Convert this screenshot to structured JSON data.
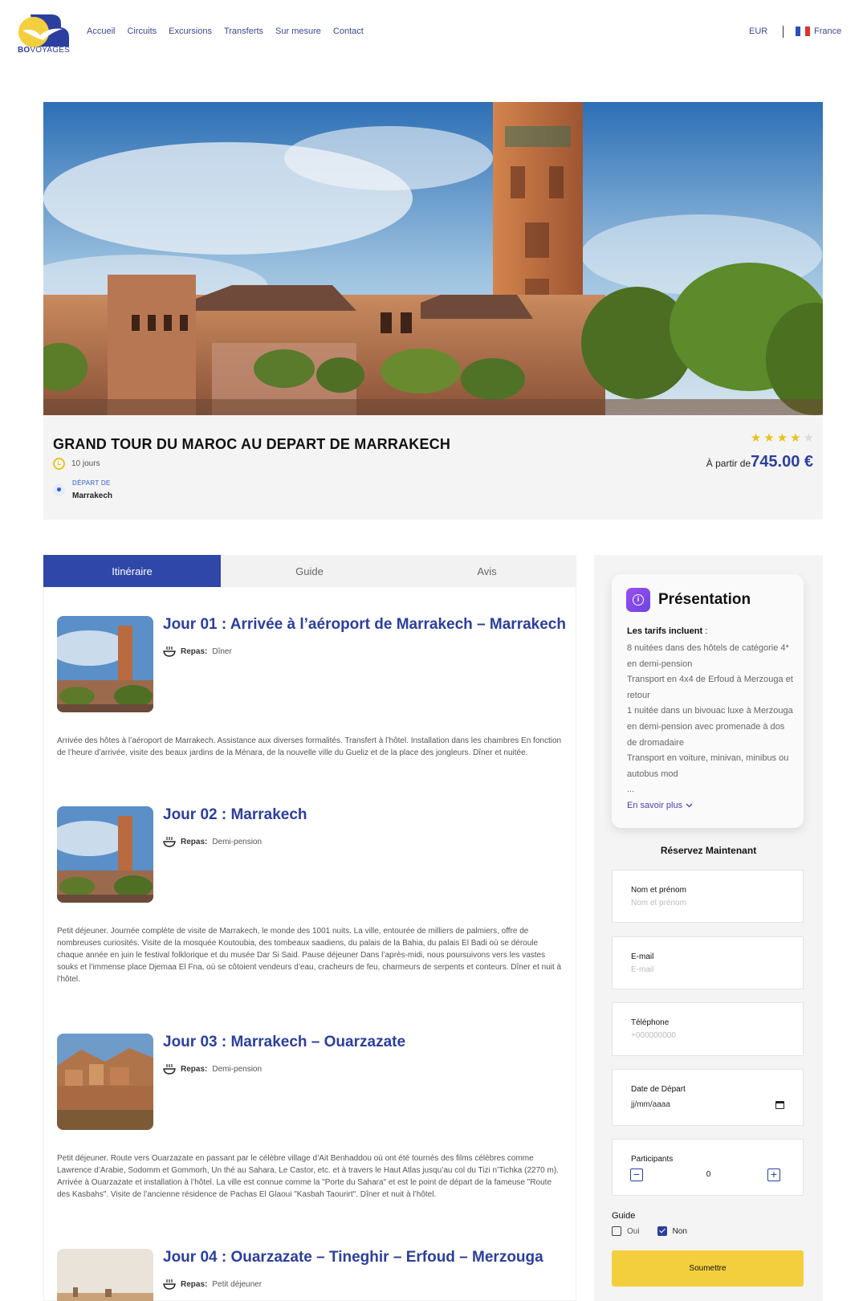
{
  "brand": {
    "logo_bold": "BO",
    "logo_rest": "VOYAGES"
  },
  "nav": {
    "items": [
      "Accueil",
      "Circuits",
      "Excursions",
      "Transferts",
      "Sur mesure",
      "Contact"
    ]
  },
  "header": {
    "currency": "EUR",
    "language": "France"
  },
  "tour": {
    "title": "GRAND TOUR DU MAROC AU DEPART DE MARRAKECH",
    "duration": "10 jours",
    "depart_label": "DÉPART DE",
    "depart_city": "Marrakech",
    "rating": 4,
    "rating_max": 5,
    "price_prefix": "À partir de",
    "price_value": "745.00 €"
  },
  "tabs": [
    "Itinéraire",
    "Guide",
    "Avis"
  ],
  "itinerary": {
    "meal_label": "Repas:",
    "days": [
      {
        "title": "Jour 01 : Arrivée à l’aéroport de Marrakech – Marrakech",
        "meal": "Dîner",
        "text": "Arrivée des hôtes à l’aéroport de Marrakech. Assistance aux diverses formalités. Transfert à l’hôtel. Installation dans les chambres En fonction de l’heure d’arrivée, visite des beaux jardins de la Ménara, de la nouvelle ville du Gueliz et de la place des jongleurs. Dîner et nuitée."
      },
      {
        "title": "Jour 02 : Marrakech",
        "meal": "Demi-pension",
        "text": "Petit déjeuner. Journée complète de visite de Marrakech, le monde des 1001 nuits. La ville, entourée de milliers de palmiers, offre de nombreuses curiosités. Visite de la mosquée Koutoubia, des tombeaux saadiens, du palais de la Bahia, du palais El Badi où se déroule chaque année en juin le festival folklorique et du musée Dar Si Said. Pause déjeuner Dans l’après-midi, nous poursuivons vers les vastes souks et l’immense place Djemaa El Fna, où se côtoient vendeurs d’eau, cracheurs de feu, charmeurs de serpents et conteurs. Dîner et nuit à l’hôtel."
      },
      {
        "title": "Jour 03 : Marrakech – Ouarzazate",
        "meal": "Demi-pension",
        "text": "Petit déjeuner. Route vers Ouarzazate en passant par le célèbre village d’Ait Benhaddou où ont été tournés des films célèbres comme Lawrence d’Arabie, Sodomm et Gommorh, Un thé au Sahara, Le Castor, etc. et à travers le Haut Atlas jusqu’au col du Tizi n’Tichka (2270 m). Arrivée à Ouarzazate et installation à l’hôtel. La ville est connue comme la \"Porte du Sahara\" et est le point de départ de la fameuse \"Route des Kasbahs\". Visite de l’ancienne résidence de Pachas El Glaoui \"Kasbah Taourirt\". Dîner et nuit à l’hôtel."
      },
      {
        "title": "Jour 04 : Ouarzazate – Tineghir – Erfoud – Merzouga",
        "meal": "Petit déjeuner",
        "text": ""
      }
    ]
  },
  "presentation": {
    "title": "Présentation",
    "heading_bold": "Les tarifs incluent",
    "heading_rest": " :",
    "lines": [
      "8 nuitées dans des hôtels de catégorie 4* en demi-pension",
      "Transport en 4x4 de Erfoud à Merzouga et retour",
      "1 nuitée dans un bivouac luxe à Merzouga en demi-pension avec promenade à dos de dromadaire",
      "Transport en voiture, minivan, minibus ou autobus mod",
      "..."
    ],
    "more": "En savoir plus"
  },
  "booking": {
    "title": "Réservez Maintenant",
    "name_label": "Nom et prénom",
    "name_placeholder": "Nom et prénom",
    "email_label": "E-mail",
    "email_placeholder": "E-mail",
    "phone_label": "Téléphone",
    "phone_placeholder": "+000000000",
    "date_label": "Date de Départ",
    "date_value": "jj/mm/aaaa",
    "participants_label": "Participants",
    "participants_value": "0",
    "guide_label": "Guide",
    "guide_yes": "Oui",
    "guide_no": "Non",
    "guide_selected": "Non",
    "submit": "Soumettre"
  },
  "colors": {
    "primary": "#2e47a8",
    "accent": "#f4cf3d",
    "star": "#e8c21b"
  }
}
